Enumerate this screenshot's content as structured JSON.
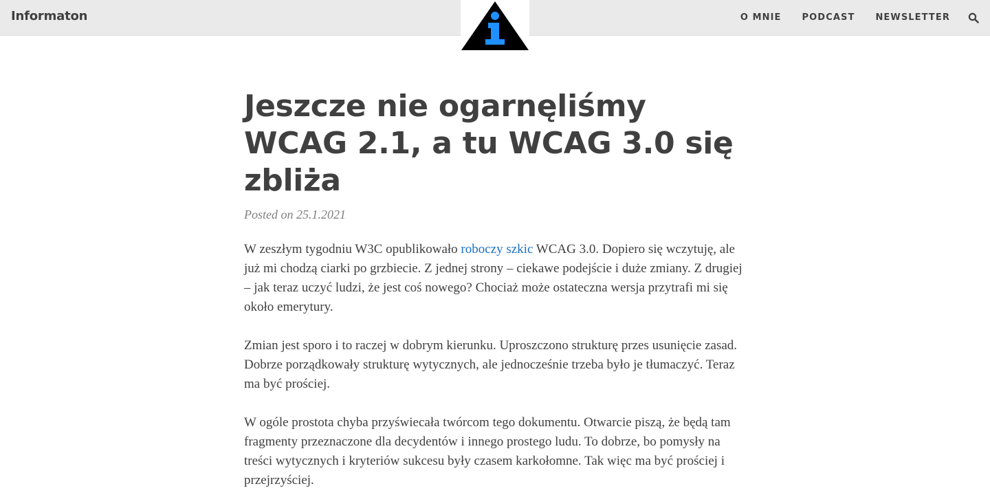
{
  "site": {
    "brand": "Informaton"
  },
  "nav": {
    "items": [
      {
        "label": "O MNIE"
      },
      {
        "label": "PODCAST"
      },
      {
        "label": "NEWSLETTER"
      }
    ],
    "search_icon": "search-icon"
  },
  "logo": {
    "icon": "info-triangle-icon",
    "colors": {
      "triangle": "#000000",
      "glyph": "#1e90ff"
    }
  },
  "post": {
    "title": "Jeszcze nie ogarnęliśmy WCAG 2.1, a tu WCAG 3.0 się zbliża",
    "meta": "Posted on 25.1.2021",
    "paragraphs": [
      {
        "before": "W zeszłym tygodniu W3C opublikowało ",
        "link": "roboczy szkic",
        "after": " WCAG 3.0. Dopiero się wczytuję, ale już mi chodzą ciarki po grzbiecie. Z jednej strony – ciekawe podejście i duże zmiany. Z drugiej – jak teraz uczyć ludzi, że jest coś nowego? Chociaż może ostateczna wersja przytrafi mi się około emerytury."
      },
      {
        "text": "Zmian jest sporo i to raczej w dobrym kierunku. Uproszczono strukturę przes usunięcie zasad. Dobrze porządkowały strukturę wytycznych, ale jednocześnie trzeba było je tłumaczyć. Teraz ma być prościej."
      },
      {
        "text": "W ogóle prostota chyba przyświecała twórcom tego dokumentu. Otwarcie piszą, że będą tam fragmenty przeznaczone dla decydentów i innego prostego ludu. To dobrze, bo pomysły na treści wytycznych i kryteriów sukcesu były czasem karkołomne. Tak więc ma być prościej i przejrzyściej."
      }
    ]
  },
  "colors": {
    "navbar_bg": "#eaeaea",
    "text": "#404040",
    "meta": "#808080",
    "link": "#1a6fc4"
  }
}
